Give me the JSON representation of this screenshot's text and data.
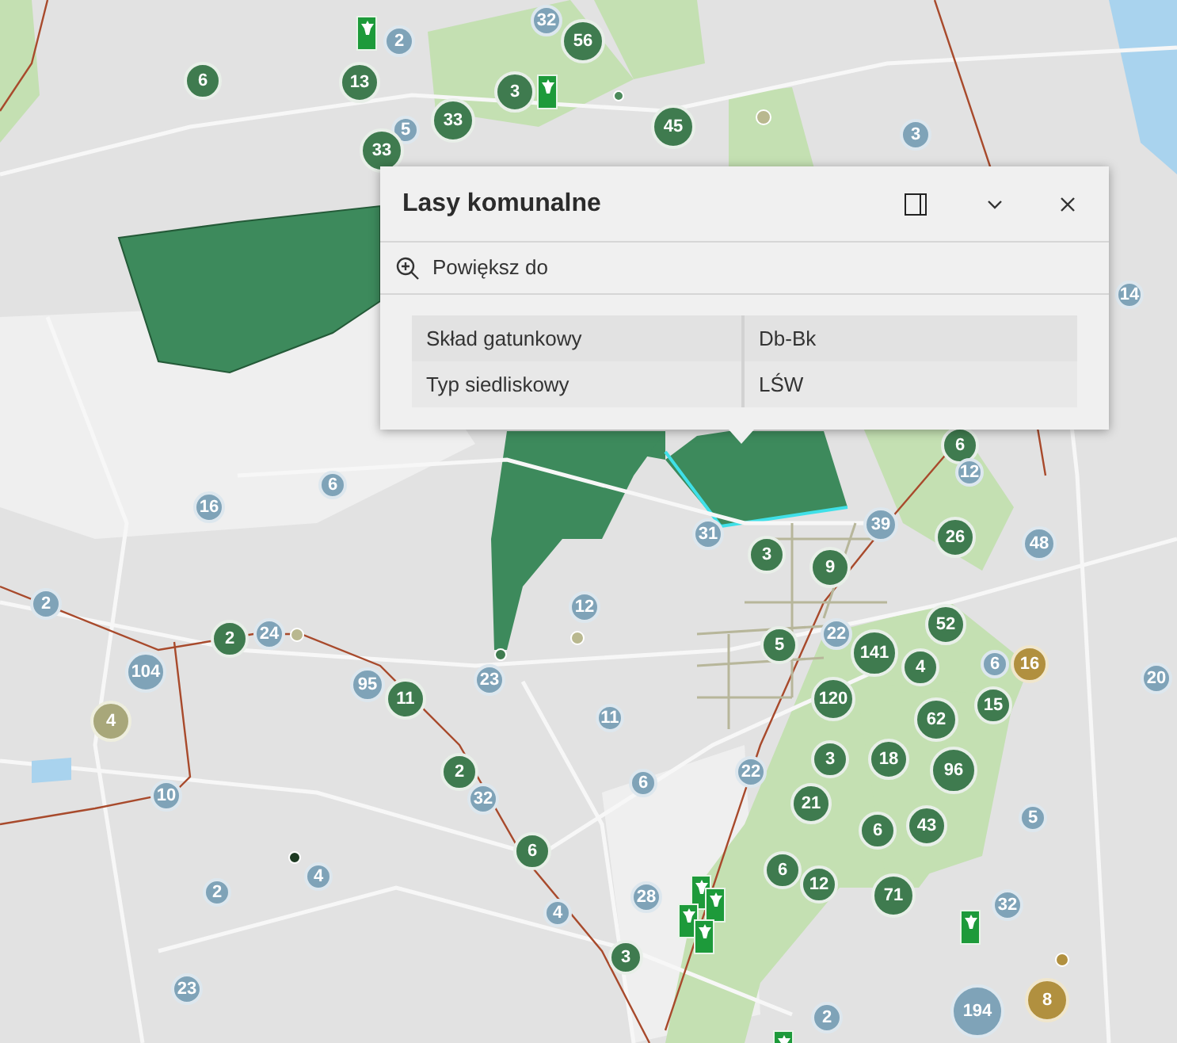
{
  "popup": {
    "title": "Lasy komunalne",
    "actions": [
      {
        "label": "Powiększ do"
      }
    ],
    "fields": [
      {
        "label": "Skład gatunkowy",
        "value": "Db-Bk"
      },
      {
        "label": "Typ siedliskowy",
        "value": "LŚW"
      }
    ]
  },
  "map": {
    "markers": [
      {
        "label": "2",
        "kind": "point"
      },
      {
        "label": "32",
        "kind": "point"
      },
      {
        "label": "56",
        "kind": "forest"
      },
      {
        "label": "6",
        "kind": "forest"
      },
      {
        "label": "13",
        "kind": "forest"
      },
      {
        "label": "3",
        "kind": "forest"
      },
      {
        "label": "33",
        "kind": "forest"
      },
      {
        "label": "5",
        "kind": "point"
      },
      {
        "label": "45",
        "kind": "forest"
      },
      {
        "label": "3",
        "kind": "point"
      },
      {
        "label": "33",
        "kind": "forest"
      },
      {
        "label": "14",
        "kind": "point"
      },
      {
        "label": "6",
        "kind": "forest"
      },
      {
        "label": "12",
        "kind": "point"
      },
      {
        "label": "6",
        "kind": "point"
      },
      {
        "label": "16",
        "kind": "point"
      },
      {
        "label": "39",
        "kind": "point"
      },
      {
        "label": "31",
        "kind": "point"
      },
      {
        "label": "26",
        "kind": "forest"
      },
      {
        "label": "48",
        "kind": "point"
      },
      {
        "label": "3",
        "kind": "forest"
      },
      {
        "label": "9",
        "kind": "forest"
      },
      {
        "label": "2",
        "kind": "point"
      },
      {
        "label": "12",
        "kind": "point"
      },
      {
        "label": "52",
        "kind": "forest"
      },
      {
        "label": "2",
        "kind": "forest"
      },
      {
        "label": "24",
        "kind": "point"
      },
      {
        "label": "5",
        "kind": "forest"
      },
      {
        "label": "22",
        "kind": "point"
      },
      {
        "label": "141",
        "kind": "forest"
      },
      {
        "label": "104",
        "kind": "point"
      },
      {
        "label": "95",
        "kind": "point"
      },
      {
        "label": "11",
        "kind": "forest"
      },
      {
        "label": "23",
        "kind": "point"
      },
      {
        "label": "120",
        "kind": "forest"
      },
      {
        "label": "4",
        "kind": "forest"
      },
      {
        "label": "15",
        "kind": "forest"
      },
      {
        "label": "6",
        "kind": "point"
      },
      {
        "label": "16",
        "kind": "gold"
      },
      {
        "label": "20",
        "kind": "point"
      },
      {
        "label": "4",
        "kind": "olive"
      },
      {
        "label": "11",
        "kind": "point"
      },
      {
        "label": "62",
        "kind": "forest"
      },
      {
        "label": "10",
        "kind": "point"
      },
      {
        "label": "2",
        "kind": "forest"
      },
      {
        "label": "32",
        "kind": "point"
      },
      {
        "label": "6",
        "kind": "point"
      },
      {
        "label": "22",
        "kind": "point"
      },
      {
        "label": "21",
        "kind": "forest"
      },
      {
        "label": "3",
        "kind": "forest"
      },
      {
        "label": "18",
        "kind": "forest"
      },
      {
        "label": "96",
        "kind": "forest"
      },
      {
        "label": "6",
        "kind": "forest"
      },
      {
        "label": "6",
        "kind": "forest"
      },
      {
        "label": "43",
        "kind": "forest"
      },
      {
        "label": "5",
        "kind": "point"
      },
      {
        "label": "2",
        "kind": "point"
      },
      {
        "label": "4",
        "kind": "point"
      },
      {
        "label": "4",
        "kind": "point"
      },
      {
        "label": "28",
        "kind": "point"
      },
      {
        "label": "6",
        "kind": "forest"
      },
      {
        "label": "12",
        "kind": "forest"
      },
      {
        "label": "71",
        "kind": "forest"
      },
      {
        "label": "32",
        "kind": "point"
      },
      {
        "label": "23",
        "kind": "point"
      },
      {
        "label": "3",
        "kind": "forest"
      },
      {
        "label": "2",
        "kind": "point"
      },
      {
        "label": "194",
        "kind": "point"
      },
      {
        "label": "8",
        "kind": "gold"
      }
    ]
  }
}
